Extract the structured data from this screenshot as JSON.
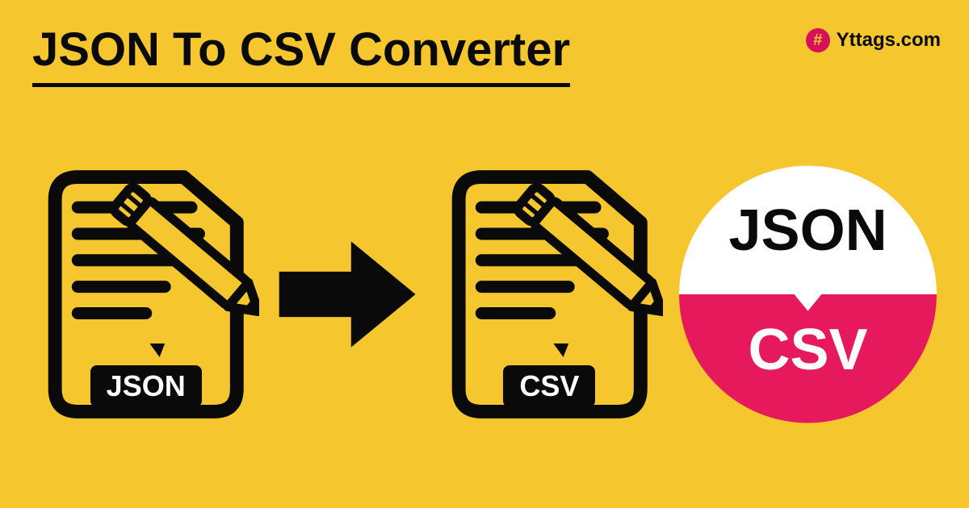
{
  "header": {
    "title": "JSON To CSV Converter",
    "brand": "Yttags.com",
    "brand_symbol": "#"
  },
  "file_labels": {
    "source": "JSON",
    "target": "CSV"
  },
  "badge": {
    "top": "JSON",
    "bottom": "CSV"
  },
  "colors": {
    "background": "#f6c62e",
    "foreground": "#0a0a0a",
    "accent": "#e6195c",
    "white": "#ffffff"
  }
}
